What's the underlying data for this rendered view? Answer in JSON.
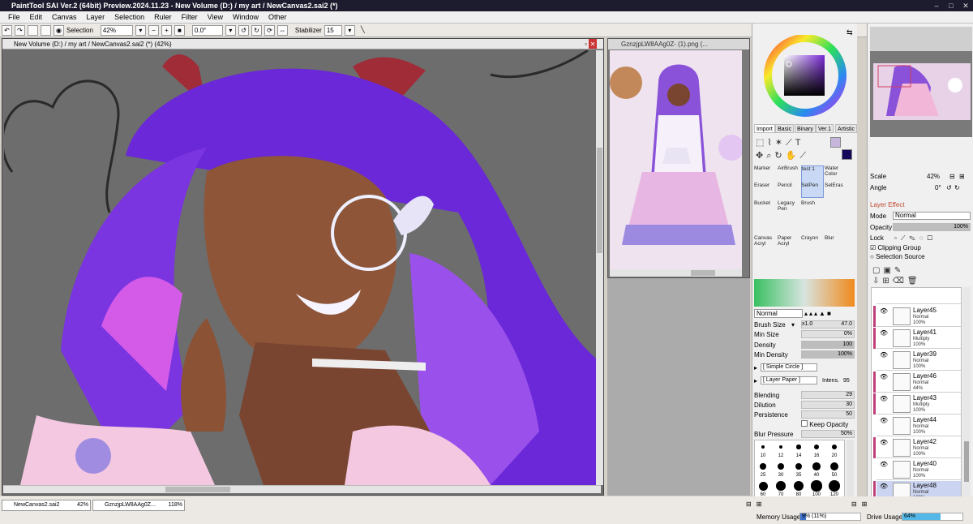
{
  "app": {
    "title": "PaintTool SAI Ver.2 (64bit) Preview.2024.11.23 - New Volume (D:) / my art / NewCanvas2.sai2 (*)"
  },
  "menu": [
    "File",
    "Edit",
    "Canvas",
    "Layer",
    "Selection",
    "Ruler",
    "Filter",
    "View",
    "Window",
    "Other"
  ],
  "toolbar": {
    "selection_label": "Selection",
    "zoom": "42%",
    "rotation": "0.0°",
    "stabilizer_label": "Stabilizer",
    "stabilizer_value": "15"
  },
  "doc": {
    "title": "New Volume (D:) / my art / NewCanvas2.sai2 (*) (42%)"
  },
  "ref": {
    "title": "GznzjpLW8AAg0Z- (1).png (..."
  },
  "tool_tabs": [
    "Import",
    "Basic",
    "Binary",
    "Ver.1",
    "Artistic"
  ],
  "tools": [
    {
      "label": "Marker"
    },
    {
      "label": "AirBrush"
    },
    {
      "label": "test 1"
    },
    {
      "label": "Water Color"
    },
    {
      "label": "Eraser"
    },
    {
      "label": "Pencil"
    },
    {
      "label": "SelPen"
    },
    {
      "label": "SelEras"
    },
    {
      "label": "Bucket"
    },
    {
      "label": "Legacy Pen"
    },
    {
      "label": "Brush"
    },
    {
      "label": ""
    },
    {
      "label": "Canvas Acryl"
    },
    {
      "label": "Paper Acryl"
    },
    {
      "label": "Crayon"
    },
    {
      "label": "Blur"
    }
  ],
  "brush": {
    "blend_mode": "Normal",
    "size_label": "Brush Size",
    "size_mult": "x1.0",
    "size": "47.0",
    "min_size_label": "Min Size",
    "min_size": "0%",
    "density_label": "Density",
    "density": "100",
    "min_density_label": "Min Density",
    "min_density": "100%",
    "shape": "[ Simple Circle ]",
    "texture": "[ Layer Paper ]",
    "intens_label": "Intens.",
    "intens": "95",
    "blending_label": "Blending",
    "blending": "29",
    "dilution_label": "Dilution",
    "dilution": "30",
    "persistence_label": "Persistence",
    "persistence": "50",
    "keep_opacity": "Keep Opacity",
    "blur_label": "Blur Pressure",
    "blur": "50%",
    "sizes": [
      "10",
      "12",
      "14",
      "16",
      "20",
      "25",
      "30",
      "35",
      "40",
      "50",
      "60",
      "70",
      "80",
      "100",
      "120"
    ]
  },
  "nav": {
    "scale_label": "Scale",
    "scale": "42%",
    "angle_label": "Angle",
    "angle": "0°"
  },
  "layer_panel": {
    "effect": "Layer Effect",
    "mode_label": "Mode",
    "mode": "Normal",
    "opacity_label": "Opacity",
    "opacity": "100%",
    "lock_label": "Lock",
    "clipping": "Clipping Group",
    "selection_source": "Selection Source"
  },
  "layers": [
    {
      "name": "Layer45",
      "mode": "Normal",
      "opacity": "100%"
    },
    {
      "name": "Layer41",
      "mode": "Multiply",
      "opacity": "100%"
    },
    {
      "name": "Layer39",
      "mode": "Normal",
      "opacity": "100%"
    },
    {
      "name": "Layer46",
      "mode": "Normal",
      "opacity": "44%"
    },
    {
      "name": "Layer43",
      "mode": "Multiply",
      "opacity": "100%"
    },
    {
      "name": "Layer44",
      "mode": "Normal",
      "opacity": "100%"
    },
    {
      "name": "Layer42",
      "mode": "Normal",
      "opacity": "100%"
    },
    {
      "name": "Layer40",
      "mode": "Normal",
      "opacity": "100%"
    },
    {
      "name": "Layer48",
      "mode": "Normal",
      "opacity": "100%"
    }
  ],
  "doc_tabs": [
    {
      "name": "NewCanvas2.sai2",
      "zoom": "42%"
    },
    {
      "name": "GznzjpLW8AAg0Z...",
      "zoom": "118%"
    }
  ],
  "status": {
    "memory_label": "Memory Usage",
    "memory": "9% (11%)",
    "memory_pct": 9,
    "drive_label": "Drive Usage",
    "drive": "64%",
    "drive_pct": 64
  },
  "colors": {
    "accent": "#3b6fc9",
    "layer_strip": "#c0407a",
    "current_color": "#14085a",
    "secondary_color": "#c6b6dc"
  }
}
